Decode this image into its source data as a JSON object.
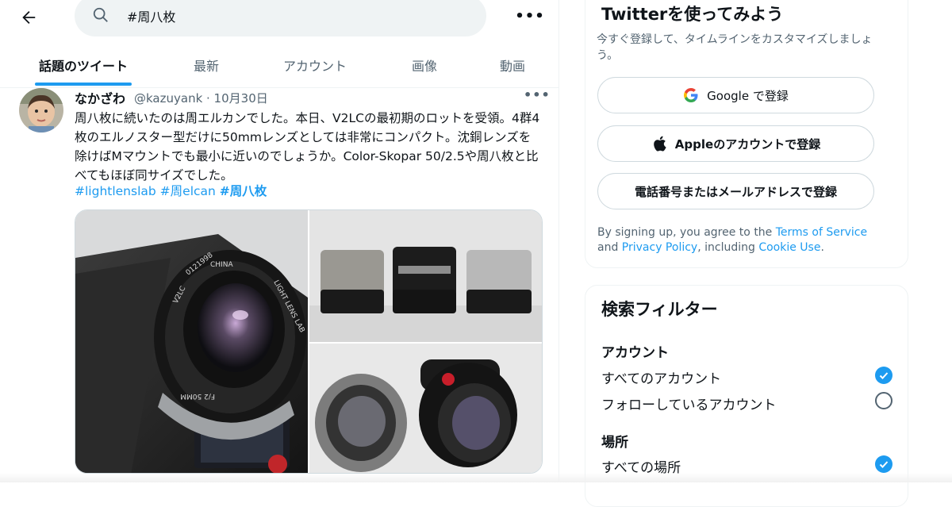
{
  "search": {
    "query": "#周八枚"
  },
  "tabs": [
    {
      "label": "話題のツイート"
    },
    {
      "label": "最新"
    },
    {
      "label": "アカウント"
    },
    {
      "label": "画像"
    },
    {
      "label": "動画"
    }
  ],
  "tweet": {
    "name": "なかざわ",
    "meta": "@kazuyank · 10月30日",
    "body": "周八枚に続いたのは周エルカンでした。本日、V2LCの最初期のロットを受領。4群4枚のエルノスター型だけに50mmレンズとしては非常にコンパクト。沈銅レンズを除けばMマウントでも最小に近いのでしょうか。Color-Skopar 50/2.5や周八枚と比べてもほぼ同サイズでした。",
    "hashtags": [
      "#lightlenslab",
      "#周elcan",
      "#周八枚"
    ],
    "lens_text": [
      "CHINA",
      "LIGHT LENS LAB",
      "V2LC",
      "0121998",
      "F/2 50MM"
    ]
  },
  "signup": {
    "title": "Twitterを使ってみよう",
    "subtitle": "今すぐ登録して、タイムラインをカスタマイズしましょう。",
    "google": "Google で登録",
    "apple": "Appleのアカウントで登録",
    "phone": "電話番号またはメールアドレスで登録",
    "terms_prefix": "By signing up, you agree to the ",
    "terms_link": "Terms of Service",
    "terms_and": " and ",
    "privacy_link": "Privacy Policy",
    "terms_mid": ", including ",
    "cookie_link": "Cookie Use",
    "terms_end": "."
  },
  "filter": {
    "title": "検索フィルター",
    "account_heading": "アカウント",
    "account_all": "すべてのアカウント",
    "account_following": "フォローしているアカウント",
    "place_heading": "場所",
    "place_all": "すべての場所"
  },
  "colors": {
    "accent": "#1d9bf0",
    "text": "#0f1419",
    "muted": "#536471"
  }
}
